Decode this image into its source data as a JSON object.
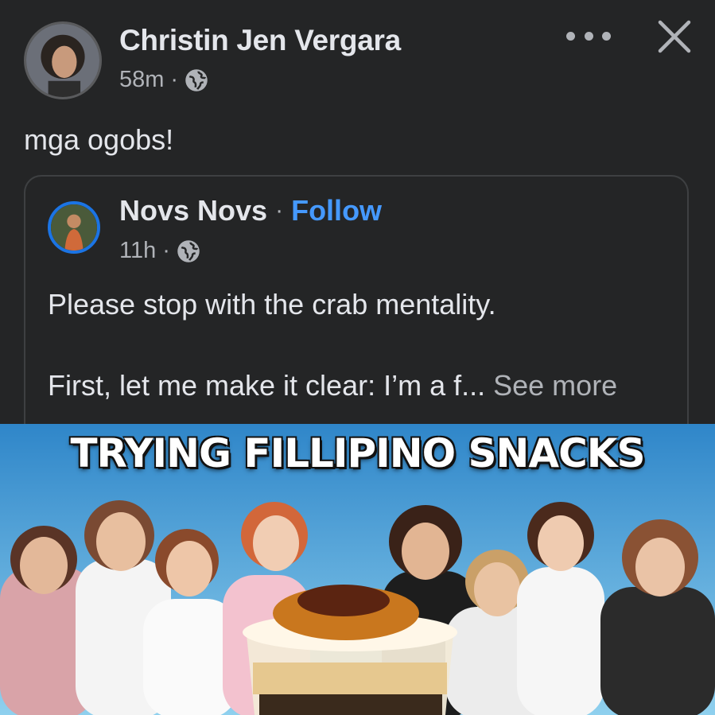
{
  "post": {
    "author_name": "Christin Jen Vergara",
    "time": "58m",
    "separator": "·",
    "privacy_icon": "globe-icon",
    "text": "mga ogobs!"
  },
  "header_actions": {
    "more_icon": "more-horizontal-icon",
    "close_icon": "close-icon"
  },
  "shared_post": {
    "author_name": "Novs Novs",
    "separator": "·",
    "follow_label": "Follow",
    "time": "11h",
    "privacy_icon": "globe-icon",
    "line1": "Please stop with the crab mentality.",
    "line2": "First, let me make it clear: I’m a f...",
    "see_more_label": "See more"
  },
  "thumbnail": {
    "title": "TRYING FILLIPINO SNACKS"
  },
  "colors": {
    "background": "#242526",
    "text_primary": "#e4e6eb",
    "text_secondary": "#b0b3b8",
    "link": "#4599ff",
    "avatar_ring": "#1b74e4"
  }
}
